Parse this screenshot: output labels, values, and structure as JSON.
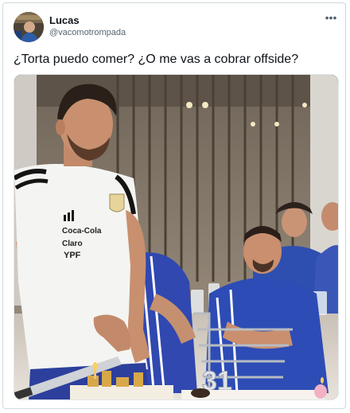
{
  "tweet": {
    "author": {
      "name": "Lucas",
      "handle": "@vacomotrompada"
    },
    "more_icon": "more-dots-icon",
    "text": "¿Torta puedo comer? ¿O me vas a cobrar offside?",
    "media": {
      "shirt_text": [
        "Coca-Cola",
        "Claro",
        "YPF"
      ],
      "cake_number": "31"
    }
  },
  "colors": {
    "name": "#0f1419",
    "handle": "#536471",
    "border": "#cfd9de"
  }
}
